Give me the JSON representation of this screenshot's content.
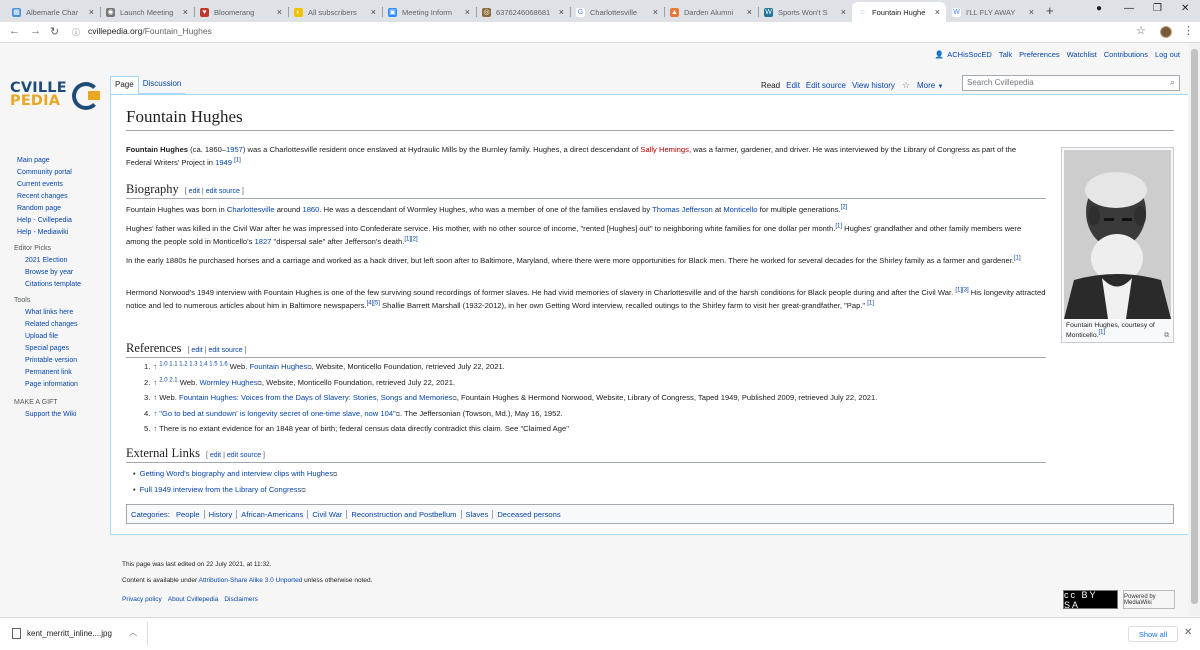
{
  "browser": {
    "tabs": [
      {
        "title": "Albemarle Char",
        "color": "#4a90d9",
        "glyph": "▦"
      },
      {
        "title": "Launch Meeting",
        "color": "#777777",
        "glyph": "◉"
      },
      {
        "title": "Bloomerang",
        "color": "#c0392b",
        "glyph": "♥"
      },
      {
        "title": "All subscribers",
        "color": "#f2c200",
        "glyph": "◐"
      },
      {
        "title": "Meeting Inform",
        "color": "#2d8cff",
        "glyph": "▣"
      },
      {
        "title": "6376246068681",
        "color": "#8b6d3c",
        "glyph": "◎"
      },
      {
        "title": "Charlottesville",
        "color": "#ffffff",
        "glyph": "G"
      },
      {
        "title": "Darden Alumni",
        "color": "#e6793a",
        "glyph": "▲"
      },
      {
        "title": "Sports Won't S",
        "color": "#21759b",
        "glyph": "W"
      },
      {
        "title": "Fountain Hughe",
        "color": "#ffffff",
        "glyph": "◌"
      },
      {
        "title": "I'LL FLY AWAY",
        "color": "#ffffff",
        "glyph": "W"
      }
    ],
    "active_tab_index": 9,
    "url_domain": "cvillepedia.org",
    "url_path": "/Fountain_Hughes"
  },
  "wiki": {
    "personal": [
      "ACHisSocED",
      "Talk",
      "Preferences",
      "Watchlist",
      "Contributions",
      "Log out"
    ],
    "logo_line1": "CVILLE",
    "logo_line2": "PEDIA",
    "left_tabs": [
      "Page",
      "Discussion"
    ],
    "right_tabs": [
      "Read",
      "Edit",
      "Edit source",
      "View history"
    ],
    "more_label": "More",
    "search_placeholder": "Search Cvillepedia"
  },
  "sidebar": {
    "nav": [
      "Main page",
      "Community portal",
      "Current events",
      "Recent changes",
      "Random page",
      "Help - Cvillepedia",
      "Help - Mediawiki"
    ],
    "editor_picks_head": "Editor Picks",
    "editor_picks": [
      "2021 Election",
      "Browse by year",
      "Citations template"
    ],
    "tools_head": "Tools",
    "tools": [
      "What links here",
      "Related changes",
      "Upload file",
      "Special pages",
      "Printable version",
      "Permanent link",
      "Page information"
    ],
    "gift_head": "MAKE A GIFT",
    "gift": [
      "Support the Wiki"
    ]
  },
  "article": {
    "title": "Fountain Hughes",
    "lead_bold": "Fountain Hughes",
    "lead_1": " (ca. 1860–",
    "lead_1957": "1957",
    "lead_2": ") was a Charlottesville resident once enslaved at Hydraulic Mills by the Burnley family. Hughes, a direct descendant of ",
    "lead_sally": "Sally Hemings",
    "lead_3": ", was a farmer, gardener, and driver. He was interviewed by the Library of Congress as part of the Federal Writers' Project in ",
    "lead_1949": "1949",
    "lead_ref": "[1]",
    "bio_heading": "Biography",
    "edit_label": "edit",
    "edit_source_label": "edit source",
    "bio_p1_a": "Fountain Hughes was born in ",
    "bio_p1_cville": "Charlottesville",
    "bio_p1_b": " around ",
    "bio_p1_1860": "1860",
    "bio_p1_c": ". He was a descendant of Wormley Hughes, who was a member of one of the families enslaved by ",
    "bio_p1_tj": "Thomas Jefferson",
    "bio_p1_d": " at ",
    "bio_p1_monti": "Monticello",
    "bio_p1_e": " for multiple generations.",
    "bio_p1_ref": "[2]",
    "bio_p2_a": "Hughes' father was killed in the Civil War after he was impressed into Confederate service. His mother, with no other source of income, \"rented [Hughes] out\" to neighboring white families for one dollar per month.",
    "bio_p2_ref1": "[1]",
    "bio_p2_b": " Hughes' grandfather and other family members were among the people sold in Monticello's ",
    "bio_p2_1827": "1827",
    "bio_p2_c": " \"dispersal sale\" after Jefferson's death.",
    "bio_p2_ref2": "[1][2]",
    "bio_p3": "In the early 1880s he purchased horses and a carriage and worked as a hack driver, but left soon after to Baltimore, Maryland, where there were more opportunities for Black men. There he worked for several decades for the Shirley family as a farmer and gardener.",
    "bio_p3_ref": "[1]",
    "bio_p4_a": "Hermond Norwood's 1949 interview with Fountain Hughes is one of the few surviving sound recordings of former slaves. He had vivid memories of slavery in Charlottesville and of the harsh conditions for Black people during and after the Civil War.",
    "bio_p4_ref1": "[1][3]",
    "bio_p4_b": " His longevity attracted notice and led to numerous articles about him in Baltimore newspapers.",
    "bio_p4_ref2": "[4][5]",
    "bio_p4_c": " Shallie Barrett Marshall (1932-2012), in her own Getting Word interview, recalled outings to the Shirley farm to visit her great-grandfather, \"Pap.\"",
    "bio_p4_ref3": "[1]",
    "thumb_caption": "Fountain Hughes, courtesy of Monticello.",
    "thumb_ref": "[1]",
    "refs_heading": "References",
    "refs": [
      {
        "num": "1.",
        "back": "↑ ",
        "sups": "1.0 1.1 1.2 1.3 1.4 1.5 1.6",
        "pre": " Web. ",
        "link": "Fountain Hughes",
        "post": ", Website, Monticello Foundation, retrieved July 22, 2021."
      },
      {
        "num": "2.",
        "back": "↑ ",
        "sups": "2.0 2.1",
        "pre": " Web. ",
        "link": "Wormley Hughes",
        "post": ", Website, Monticello Foundation, retrieved July 22, 2021."
      },
      {
        "num": "3.",
        "back": "↑ ",
        "sups": "",
        "pre": "Web. ",
        "link": "Fountain Hughes: Voices from the Days of Slavery: Stories, Songs and Memories",
        "post": ", Fountain Hughes & Hermond Norwood, Website, Library of Congress, Taped 1949, Published 2009, retrieved July 22, 2021."
      },
      {
        "num": "4.",
        "back": "↑ ",
        "sups": "",
        "pre": "",
        "link": "\"Go to bed at sundown' is longevity secret of one-time slave, now 104\"",
        "post": ". The Jeffersonian (Towson, Md.), May 16, 1952."
      },
      {
        "num": "5.",
        "back": "↑ ",
        "sups": "",
        "pre": "There is no extant evidence for an 1848 year of birth; federal census data directly contradict this claim. See \"Claimed Age\"",
        "link": "",
        "post": ""
      }
    ],
    "ext_heading": "External Links",
    "ext_links": [
      "Getting Word's biography and interview clips with Hughes",
      "Full 1949 interview from the Library of Congress"
    ],
    "categories_label": "Categories",
    "categories": [
      "People",
      "History",
      "African-Americans",
      "Civil War",
      "Reconstruction and Postbellum",
      "Slaves",
      "Deceased persons"
    ]
  },
  "footer": {
    "last_edited": "This page was last edited on 22 July 2021, at 11:32.",
    "license_pre": "Content is available under ",
    "license_link": "Attribution-Share Alike 3.0 Unported",
    "license_post": " unless otherwise noted.",
    "links": [
      "Privacy policy",
      "About Cvillepedia",
      "Disclaimers"
    ],
    "cc_badge": "cc BY SA",
    "mw_badge": "Powered by MediaWiki"
  },
  "downloads": {
    "file": "kent_merritt_inline....jpg",
    "show_all": "Show all"
  }
}
